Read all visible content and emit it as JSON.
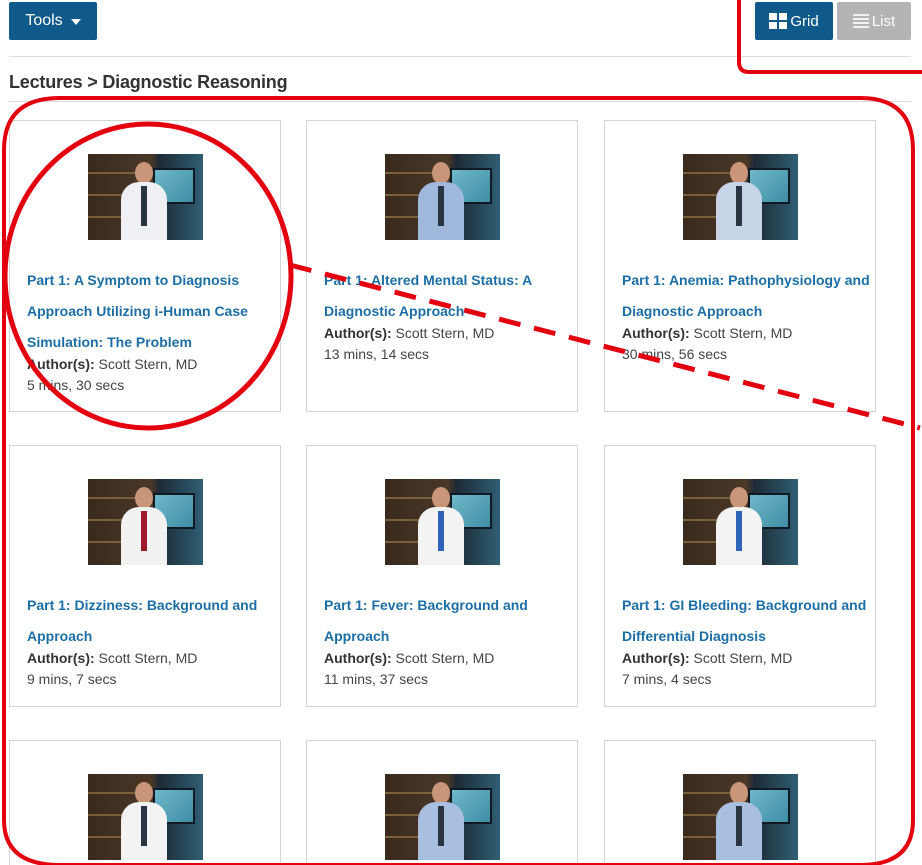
{
  "toolbar": {
    "tools_label": "Tools",
    "grid_label": "Grid",
    "list_label": "List"
  },
  "breadcrumb": "Lectures > Diagnostic Reasoning",
  "author_prefix": "Author(s):",
  "cards": [
    {
      "title": "Part 1: A Symptom to Diagnosis Approach Utilizing i-Human Case Simulation: The Problem",
      "author": "Scott Stern, MD",
      "duration": "5 mins, 30 secs"
    },
    {
      "title": "Part 1: Altered Mental Status: A Diagnostic Approach",
      "author": "Scott Stern, MD",
      "duration": "13 mins, 14 secs"
    },
    {
      "title": "Part 1: Anemia: Pathophysiology and Diagnostic Approach",
      "author": "Scott Stern, MD",
      "duration": "30 mins, 56 secs"
    },
    {
      "title": "Part 1: Dizziness: Background and Approach",
      "author": "Scott Stern, MD",
      "duration": "9 mins, 7 secs"
    },
    {
      "title": "Part 1: Fever: Background and Approach",
      "author": "Scott Stern, MD",
      "duration": "11 mins, 37 secs"
    },
    {
      "title": "Part 1: GI Bleeding: Background and Differential Diagnosis",
      "author": "Scott Stern, MD",
      "duration": "7 mins, 4 secs"
    }
  ],
  "colors": {
    "primary_button": "#0f5a8a",
    "inactive_button": "#b4b4b4",
    "link": "#1c6fa6",
    "annotation": "#e3000f"
  }
}
